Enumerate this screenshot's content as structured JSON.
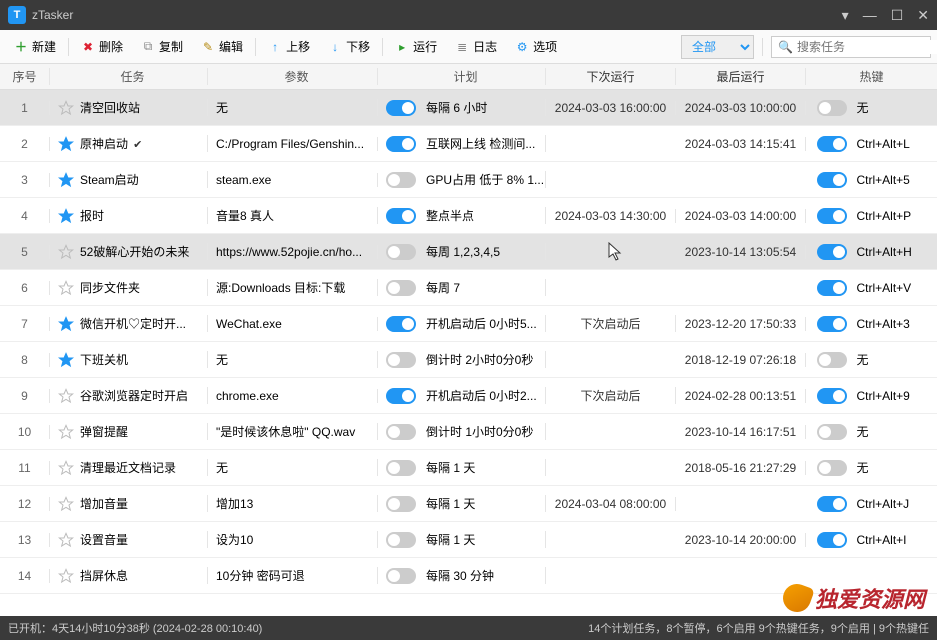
{
  "titlebar": {
    "app_name": "zTasker",
    "app_icon_letter": "T"
  },
  "toolbar": {
    "new": "新建",
    "delete": "删除",
    "copy": "复制",
    "edit": "编辑",
    "up": "上移",
    "down": "下移",
    "run": "运行",
    "log": "日志",
    "options": "选项",
    "filter_all": "全部",
    "search_placeholder": "搜索任务"
  },
  "columns": {
    "seq": "序号",
    "task": "任务",
    "param": "参数",
    "plan": "计划",
    "next": "下次运行",
    "last": "最后运行",
    "hotkey": "热键"
  },
  "rows": [
    {
      "seq": "1",
      "starred": false,
      "name": "清空回收站",
      "checked": false,
      "param": "无",
      "plan_on": true,
      "plan": "每隔 6 小时",
      "next": "2024-03-03 16:00:00",
      "last": "2024-03-03 10:00:00",
      "hot_on": false,
      "hotkey": "无",
      "sel": true
    },
    {
      "seq": "2",
      "starred": true,
      "name": "原神启动",
      "checked": true,
      "param": "C:/Program Files/Genshin...",
      "plan_on": true,
      "plan": "互联网上线 检测间...",
      "next": "",
      "last": "2024-03-03 14:15:41",
      "hot_on": true,
      "hotkey": "Ctrl+Alt+L"
    },
    {
      "seq": "3",
      "starred": true,
      "name": "Steam启动",
      "checked": false,
      "param": "steam.exe",
      "plan_on": false,
      "plan": "GPU占用 低于 8% 1...",
      "next": "",
      "last": "",
      "hot_on": true,
      "hotkey": "Ctrl+Alt+5"
    },
    {
      "seq": "4",
      "starred": true,
      "name": "报时",
      "checked": false,
      "param": "音量8 真人",
      "plan_on": true,
      "plan": "整点半点",
      "next": "2024-03-03 14:30:00",
      "last": "2024-03-03 14:00:00",
      "hot_on": true,
      "hotkey": "Ctrl+Alt+P"
    },
    {
      "seq": "5",
      "starred": false,
      "name": "52破解心开始の未来",
      "checked": false,
      "param": "https://www.52pojie.cn/ho...",
      "plan_on": false,
      "plan": "每周 1,2,3,4,5",
      "next": "",
      "last": "2023-10-14 13:05:54",
      "hot_on": true,
      "hotkey": "Ctrl+Alt+H",
      "sel": true
    },
    {
      "seq": "6",
      "starred": false,
      "name": "同步文件夹",
      "checked": false,
      "param": "源:Downloads 目标:下载",
      "plan_on": false,
      "plan": "每周 7",
      "next": "",
      "last": "",
      "hot_on": true,
      "hotkey": "Ctrl+Alt+V"
    },
    {
      "seq": "7",
      "starred": true,
      "name": "微信开机♡定时开...",
      "checked": false,
      "param": "WeChat.exe",
      "plan_on": true,
      "plan": "开机启动后 0小时5...",
      "next": "下次启动后",
      "last": "2023-12-20 17:50:33",
      "hot_on": true,
      "hotkey": "Ctrl+Alt+3"
    },
    {
      "seq": "8",
      "starred": true,
      "name": "下班关机",
      "checked": false,
      "param": "无",
      "plan_on": false,
      "plan": "倒计时 2小时0分0秒",
      "next": "",
      "last": "2018-12-19 07:26:18",
      "hot_on": false,
      "hotkey": "无"
    },
    {
      "seq": "9",
      "starred": false,
      "name": "谷歌浏览器定时开启",
      "checked": false,
      "param": "chrome.exe",
      "plan_on": true,
      "plan": "开机启动后 0小时2...",
      "next": "下次启动后",
      "last": "2024-02-28 00:13:51",
      "hot_on": true,
      "hotkey": "Ctrl+Alt+9"
    },
    {
      "seq": "10",
      "starred": false,
      "name": "弹窗提醒",
      "checked": false,
      "param": "\"是时候该休息啦\" QQ.wav",
      "plan_on": false,
      "plan": "倒计时 1小时0分0秒",
      "next": "",
      "last": "2023-10-14 16:17:51",
      "hot_on": false,
      "hotkey": "无"
    },
    {
      "seq": "11",
      "starred": false,
      "name": "清理最近文档记录",
      "checked": false,
      "param": "无",
      "plan_on": false,
      "plan": "每隔 1 天",
      "next": "",
      "last": "2018-05-16 21:27:29",
      "hot_on": false,
      "hotkey": "无"
    },
    {
      "seq": "12",
      "starred": false,
      "name": "增加音量",
      "checked": false,
      "param": "增加13",
      "plan_on": false,
      "plan": "每隔 1 天",
      "next": "2024-03-04 08:00:00",
      "last": "",
      "hot_on": true,
      "hotkey": "Ctrl+Alt+J"
    },
    {
      "seq": "13",
      "starred": false,
      "name": "设置音量",
      "checked": false,
      "param": "设为10",
      "plan_on": false,
      "plan": "每隔 1 天",
      "next": "",
      "last": "2023-10-14 20:00:00",
      "hot_on": true,
      "hotkey": "Ctrl+Alt+I"
    },
    {
      "seq": "14",
      "starred": false,
      "name": "挡屏休息",
      "checked": false,
      "param": "10分钟 密码可退",
      "plan_on": false,
      "plan": "每隔 30 分钟",
      "next": "",
      "last": "",
      "hot_on": false,
      "hotkey": ""
    }
  ],
  "statusbar": {
    "uptime_label": "已开机：",
    "uptime": "4天14小时10分38秒 (2024-02-28 00:10:40)",
    "right": "14个计划任务，8个暂停，6个启用    9个热键任务，9个启用 | 9个热键任"
  },
  "watermark": "独爱资源网"
}
